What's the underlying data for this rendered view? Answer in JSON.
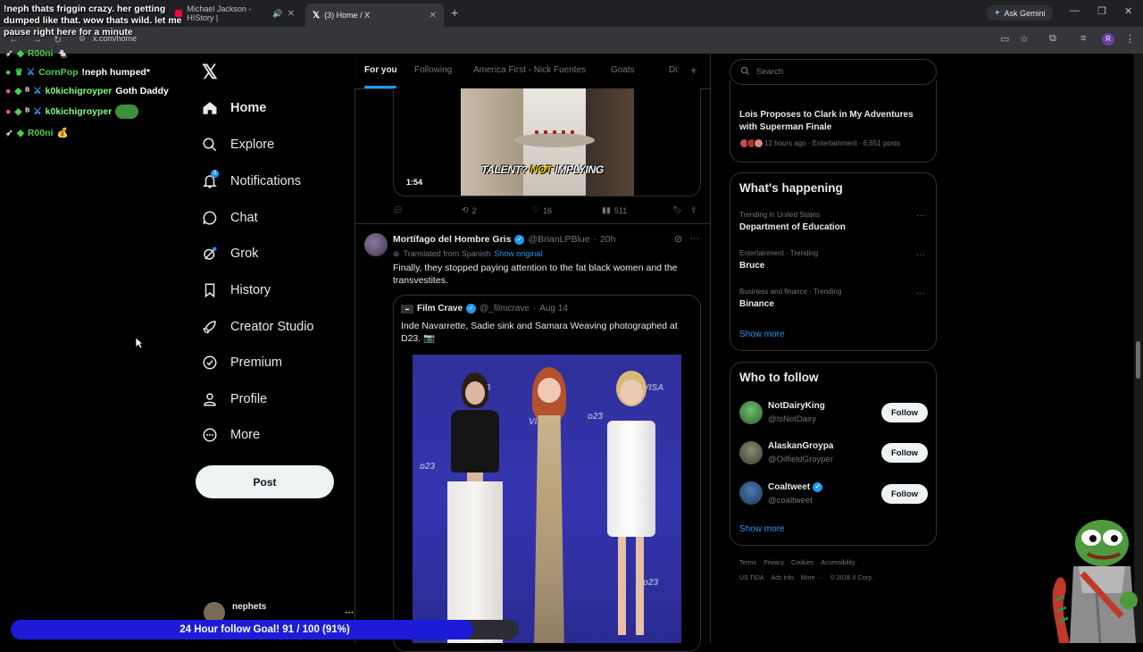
{
  "browser": {
    "tabs": [
      {
        "title": "Michael Jackson - HIStory |",
        "icon": "youtube-icon"
      },
      {
        "title": "(3) Home / X",
        "icon": "x-icon"
      }
    ],
    "url": "x.com/home",
    "gemini_label": "Ask Gemini",
    "profile_initial": "R"
  },
  "overlay": {
    "top_message": "!neph thats friggin crazy. her getting dumped like that. wow thats wild. let me pause right here for a minute",
    "chat": [
      {
        "user": "R00ni",
        "message": "",
        "color": "#4dd04d"
      },
      {
        "user": "CornPop",
        "message": "!neph humped*",
        "color": "#4dd04d"
      },
      {
        "user": "k0kichigroyper",
        "message": "Goth Daddy",
        "color": "#7cff7c"
      },
      {
        "user": "k0kichigroyper",
        "message": "",
        "color": "#7cff7c"
      },
      {
        "user": "R00ni",
        "message": "",
        "color": "#4dd04d"
      }
    ],
    "goal_text": "24 Hour follow Goal! 91 / 100 (91%)",
    "goal_progress": 0.91
  },
  "nav": {
    "items": [
      {
        "label": "Home",
        "icon": "home-icon"
      },
      {
        "label": "Explore",
        "icon": "search-icon"
      },
      {
        "label": "Notifications",
        "icon": "bell-icon",
        "badge": "3"
      },
      {
        "label": "Chat",
        "icon": "chat-icon"
      },
      {
        "label": "Grok",
        "icon": "grok-icon"
      },
      {
        "label": "History",
        "icon": "bookmark-icon"
      },
      {
        "label": "Creator Studio",
        "icon": "rocket-icon"
      },
      {
        "label": "Premium",
        "icon": "verified-icon"
      },
      {
        "label": "Profile",
        "icon": "person-icon"
      },
      {
        "label": "More",
        "icon": "more-circle-icon"
      }
    ],
    "post_label": "Post",
    "account_name": "nephets"
  },
  "feed": {
    "tabs": [
      "For you",
      "Following",
      "America First - Nick Fuentes",
      "Goats",
      "Di:"
    ],
    "post1": {
      "caption_a": "TALENT?",
      "caption_b": "NOT",
      "caption_c": "IMPLYING",
      "duration": "1:54",
      "replies": "",
      "reposts": "2",
      "likes": "16",
      "views": "511"
    },
    "post2": {
      "name": "Mortífago del Hombre Gris",
      "handle": "@BrianLPBlue",
      "time": "20h",
      "translated": "Translated from Spanish",
      "show_original": "Show original",
      "text": "Finally, they stopped paying attention to the fat black women and the transvestites.",
      "quote": {
        "name": "Film Crave",
        "handle": "@_filmcrave",
        "date": "Aug 14",
        "text": "Inde Navarrette, Sadie sink and Samara Weaving photographed at D23. 📷"
      }
    }
  },
  "right": {
    "search_placeholder": "Search",
    "lois": {
      "title": "Lois Proposes to Clark in My Adventures with Superman Finale",
      "meta": "12 hours ago · Entertainment · 6,651 posts"
    },
    "happening_title": "What's happening",
    "trends": [
      {
        "category": "Trending in United States",
        "name": "Department of Education"
      },
      {
        "category": "Entertainment · Trending",
        "name": "Bruce"
      },
      {
        "category": "Business and finance · Trending",
        "name": "Binance"
      }
    ],
    "show_more": "Show more",
    "wtf_title": "Who to follow",
    "follow_label": "Follow",
    "who_to_follow": [
      {
        "name": "NotDairyKing",
        "handle": "@IsNotDairy",
        "verified": false,
        "color": "#3f7a3f"
      },
      {
        "name": "AlaskanGroypa",
        "handle": "@OilfieldGroyper",
        "verified": false,
        "color": "#5d5d4a"
      },
      {
        "name": "Coaltweet",
        "handle": "@coaltweet",
        "verified": true,
        "color": "#2b4d7a"
      }
    ],
    "footer_row1": [
      "Terms",
      "Privacy",
      "Cookies",
      "Accessibility",
      "·"
    ],
    "footer_row2": [
      "US TIDA",
      "Ads info",
      "More ···",
      "© 2026 X Corp."
    ]
  }
}
